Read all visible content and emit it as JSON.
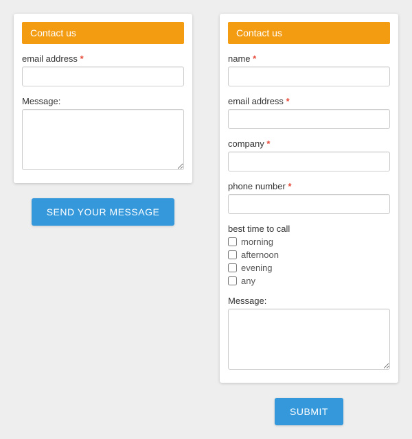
{
  "form1": {
    "header": "Contact us",
    "email_label": "email address",
    "message_label": "Message:",
    "submit_label": "SEND YOUR MESSAGE",
    "required_mark": "*"
  },
  "form2": {
    "header": "Contact us",
    "name_label": "name",
    "email_label": "email address",
    "company_label": "company",
    "phone_label": "phone number",
    "best_time_label": "best time to call",
    "options": {
      "morning": "morning",
      "afternoon": "afternoon",
      "evening": "evening",
      "any": "any"
    },
    "message_label": "Message:",
    "submit_label": "SUBMIT",
    "required_mark": "*"
  }
}
